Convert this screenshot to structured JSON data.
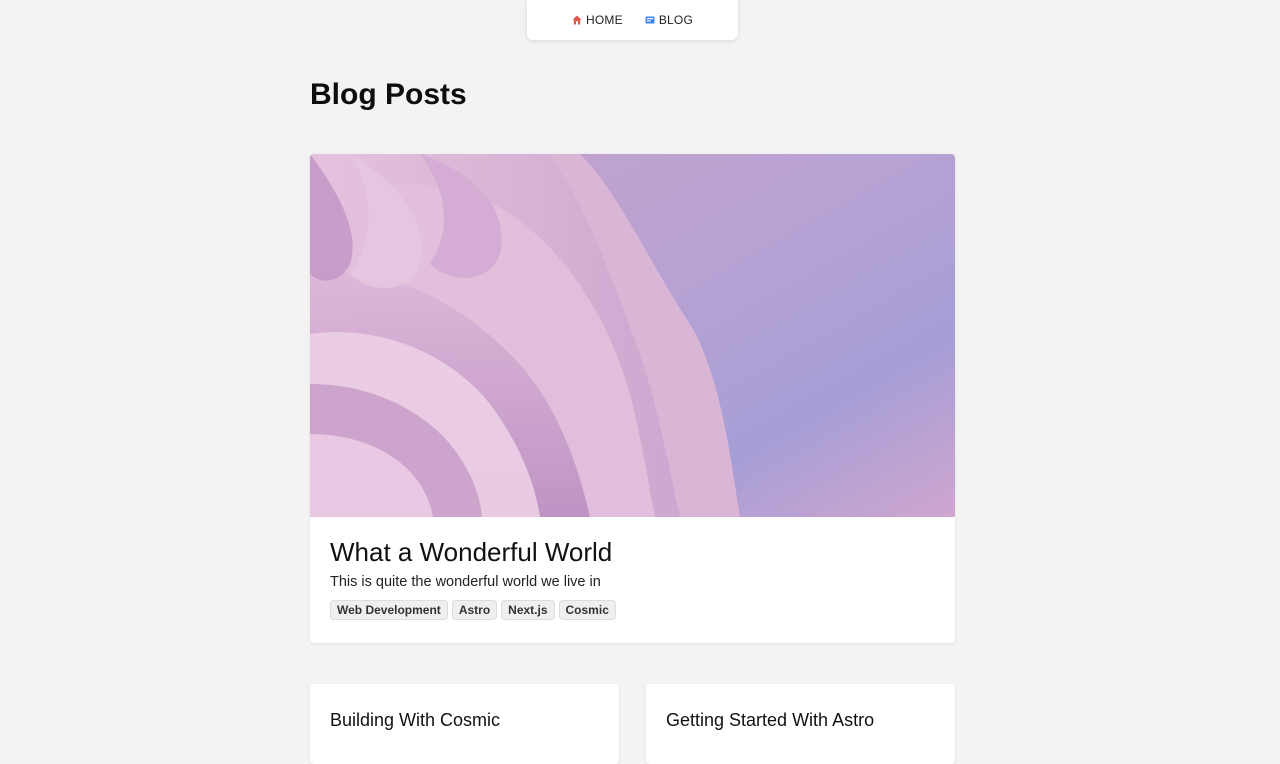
{
  "nav": {
    "items": [
      {
        "label": "HOME",
        "icon": "home-icon",
        "icon_color": "#d9534f"
      },
      {
        "label": "BLOG",
        "icon": "blog-icon",
        "icon_color": "#3b82f6"
      }
    ]
  },
  "page": {
    "title": "Blog Posts"
  },
  "featured_post": {
    "title": "What a Wonderful World",
    "description": "This is quite the wonderful world we live in",
    "tags": [
      "Web Development",
      "Astro",
      "Next.js",
      "Cosmic"
    ]
  },
  "posts": [
    {
      "title": "Building With Cosmic"
    },
    {
      "title": "Getting Started With Astro"
    }
  ]
}
